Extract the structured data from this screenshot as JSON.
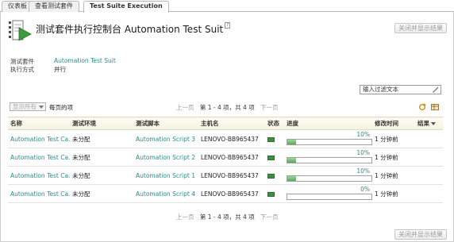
{
  "tabs": [
    {
      "label": "仪表板"
    },
    {
      "label": "查看测试套件"
    },
    {
      "label": "Test Suite Execution"
    }
  ],
  "header": {
    "title": "测试套件执行控制台 Automation Test Suit",
    "help": "?",
    "close_button": "关闭并显示结果"
  },
  "info": {
    "suite_label": "测试套件",
    "suite_value": "Automation Test Suit",
    "mode_label": "执行方式",
    "mode_value": "并行"
  },
  "filter": {
    "placeholder": "输入过滤文本"
  },
  "per_page": {
    "select": "显示所有",
    "label": "每页的项"
  },
  "pager": {
    "prev": "上一页",
    "range": "第 1 - 4 项，共 4 项",
    "next": "下一页"
  },
  "table": {
    "columns": [
      "名称",
      "测试环境",
      "测试脚本",
      "主机名",
      "状态",
      "进度",
      "修改时间",
      "结果"
    ],
    "rows": [
      {
        "name": "Automation Test Ca...",
        "env": "未分配",
        "script": "Automation Script 3",
        "host": "LENOVO-BB965437",
        "pct": "10%",
        "progress": 10,
        "time": "1 分钟前"
      },
      {
        "name": "Automation Test Ca...",
        "env": "未分配",
        "script": "Automation Script 2",
        "host": "LENOVO-BB965437",
        "pct": "10%",
        "progress": 10,
        "time": "1 分钟前"
      },
      {
        "name": "Automation Test Ca...",
        "env": "未分配",
        "script": "Automation Script 1",
        "host": "LENOVO-BB965437",
        "pct": "10%",
        "progress": 10,
        "time": "1 分钟前"
      },
      {
        "name": "Automation Test Ca...",
        "env": "未分配",
        "script": "Automation Script 4",
        "host": "LENOVO-BB965437",
        "pct": "0%",
        "progress": 0,
        "time": "1 分钟前"
      }
    ]
  },
  "footer": {
    "close_button": "关闭并显示结果"
  },
  "colors": {
    "link": "#2a8c8c",
    "progress_fill": "#5da85d",
    "status": "#3e8f3e"
  }
}
